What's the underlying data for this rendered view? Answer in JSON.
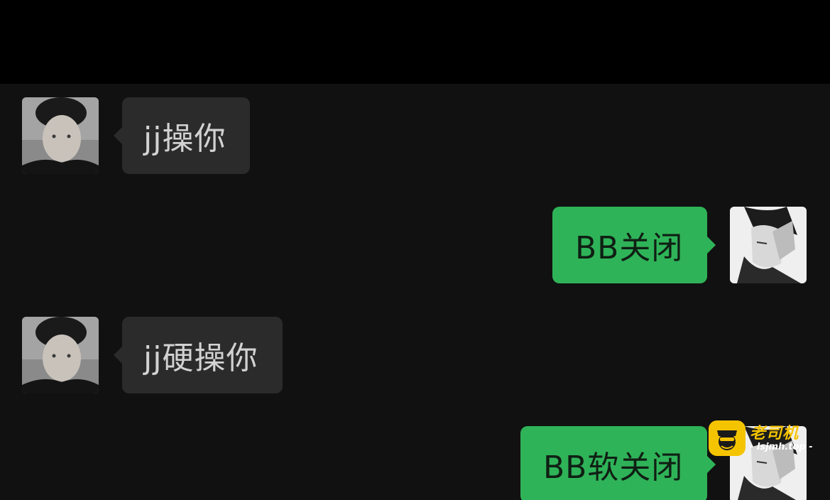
{
  "chat": {
    "messages": [
      {
        "side": "left",
        "text": "jj操你",
        "avatar": "friend-avatar"
      },
      {
        "side": "right",
        "text": "BB关闭",
        "avatar": "self-avatar"
      },
      {
        "side": "left",
        "text": "jj硬操你",
        "avatar": "friend-avatar"
      },
      {
        "side": "right",
        "text": "BB软关闭",
        "avatar": "self-avatar"
      }
    ]
  },
  "watermark": {
    "name": "老司机",
    "url": "- lsjmh.top -",
    "icon": "driver-logo-icon"
  },
  "colors": {
    "background": "#111111",
    "top_bar": "#000000",
    "incoming_bubble": "#2b2b2b",
    "outgoing_bubble": "#2fb358",
    "watermark_accent": "#f5c400"
  }
}
